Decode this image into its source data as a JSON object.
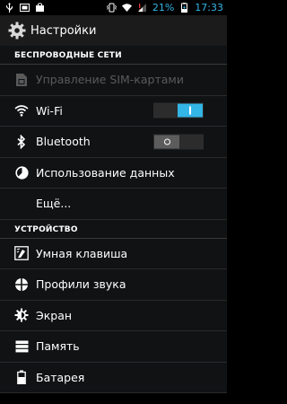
{
  "status_bar": {
    "battery_percent": "21%",
    "time": "17:33",
    "left_icons": [
      "usb-icon",
      "screenshot-icon",
      "bag-icon"
    ],
    "right_icons": [
      "vibrate-icon",
      "wifi-icon",
      "signal-icon",
      "battery-icon"
    ]
  },
  "action_bar": {
    "title": "Настройки",
    "icon": "gear-icon"
  },
  "colors": {
    "accent": "#33b5e5",
    "background": "#101214",
    "disabled_text": "#5a5a5a"
  },
  "sections": [
    {
      "header": "БЕСПРОВОДНЫЕ СЕТИ",
      "items": [
        {
          "label": "Управление SIM-картами",
          "icon": "sim-icon",
          "disabled": true
        },
        {
          "label": "Wi-Fi",
          "icon": "wifi-icon",
          "toggle": "on"
        },
        {
          "label": "Bluetooth",
          "icon": "bluetooth-icon",
          "toggle": "off"
        },
        {
          "label": "Использование данных",
          "icon": "data-usage-icon"
        },
        {
          "label": "Ещё...",
          "icon": ""
        }
      ]
    },
    {
      "header": "УСТРОЙСТВО",
      "items": [
        {
          "label": "Умная клавиша",
          "icon": "smart-key-icon"
        },
        {
          "label": "Профили звука",
          "icon": "sound-profile-icon"
        },
        {
          "label": "Экран",
          "icon": "display-icon"
        },
        {
          "label": "Память",
          "icon": "storage-icon"
        },
        {
          "label": "Батарея",
          "icon": "battery-icon"
        }
      ]
    }
  ]
}
